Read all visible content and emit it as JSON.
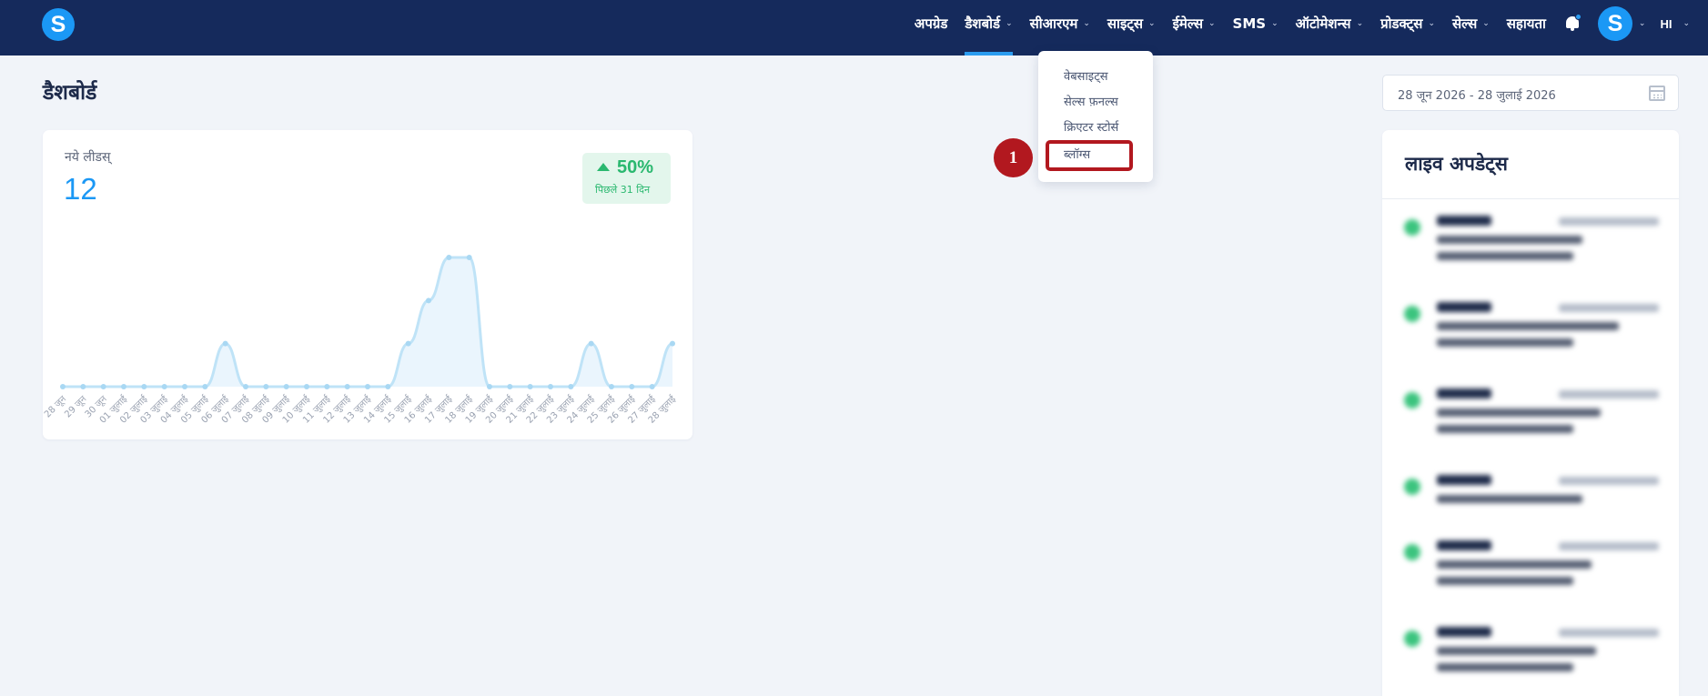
{
  "brand": {
    "logo_letter": "S"
  },
  "nav": {
    "items": [
      {
        "label": "अपग्रेड",
        "has_menu": false,
        "active": false
      },
      {
        "label": "डैशबोर्ड",
        "has_menu": true,
        "active": true
      },
      {
        "label": "सीआरएम",
        "has_menu": true,
        "active": false
      },
      {
        "label": "साइट्स",
        "has_menu": true,
        "active": false
      },
      {
        "label": "ईमेल्स",
        "has_menu": true,
        "active": false
      },
      {
        "label": "SMS",
        "has_menu": true,
        "active": false
      },
      {
        "label": "ऑटोमेशन्स",
        "has_menu": true,
        "active": false
      },
      {
        "label": "प्रोडक्ट्स",
        "has_menu": true,
        "active": false
      },
      {
        "label": "सेल्स",
        "has_menu": true,
        "active": false
      },
      {
        "label": "सहायता",
        "has_menu": false,
        "active": false
      }
    ],
    "avatar_letter": "S",
    "language": "HI",
    "chevron": "⌄"
  },
  "sites_menu": {
    "items": [
      "वेबसाइट्स",
      "सेल्स फ़नल्स",
      "क्रिएटर स्टोर्स",
      "ब्लॉग्स"
    ],
    "highlighted_index": 3
  },
  "step_badge": "1",
  "page": {
    "title": "डैशबोर्ड"
  },
  "leads_card": {
    "label": "नये लीडस्",
    "count": "12",
    "change": "50%",
    "change_period": "पिछले 31 दिन",
    "change_direction": "up"
  },
  "chart_data": {
    "type": "area",
    "categories": [
      "28 जून",
      "29 जून",
      "30 जून",
      "01 जुलाई",
      "02 जुलाई",
      "03 जुलाई",
      "04 जुलाई",
      "05 जुलाई",
      "06 जुलाई",
      "07 जुलाई",
      "08 जुलाई",
      "09 जुलाई",
      "10 जुलाई",
      "11 जुलाई",
      "12 जुलाई",
      "13 जुलाई",
      "14 जुलाई",
      "15 जुलाई",
      "16 जुलाई",
      "17 जुलाई",
      "18 जुलाई",
      "19 जुलाई",
      "20 जुलाई",
      "21 जुलाई",
      "22 जुलाई",
      "23 जुलाई",
      "24 जुलाई",
      "25 जुलाई",
      "26 जुलाई",
      "27 जुलाई",
      "28 जुलाई"
    ],
    "values": [
      0,
      0,
      0,
      0,
      0,
      0,
      0,
      0,
      1,
      0,
      0,
      0,
      0,
      0,
      0,
      0,
      0,
      1,
      2,
      3,
      3,
      0,
      0,
      0,
      0,
      0,
      1,
      0,
      0,
      0,
      1
    ],
    "ylim": [
      0,
      3
    ],
    "grid": false,
    "colors": {
      "line": "#bfe3f7",
      "fill": "#eaf5fd",
      "point": "#a9d8f3"
    }
  },
  "date_range": {
    "value": "28 जून 2026 - 28 जुलाई 2026"
  },
  "live_updates": {
    "title": "लाइव अपडेट्स"
  },
  "colors": {
    "nav_bg": "#152a5c",
    "accent": "#1b98f5",
    "positive": "#2ab86f",
    "highlight": "#b2181f",
    "page_bg": "#f1f4f9"
  }
}
